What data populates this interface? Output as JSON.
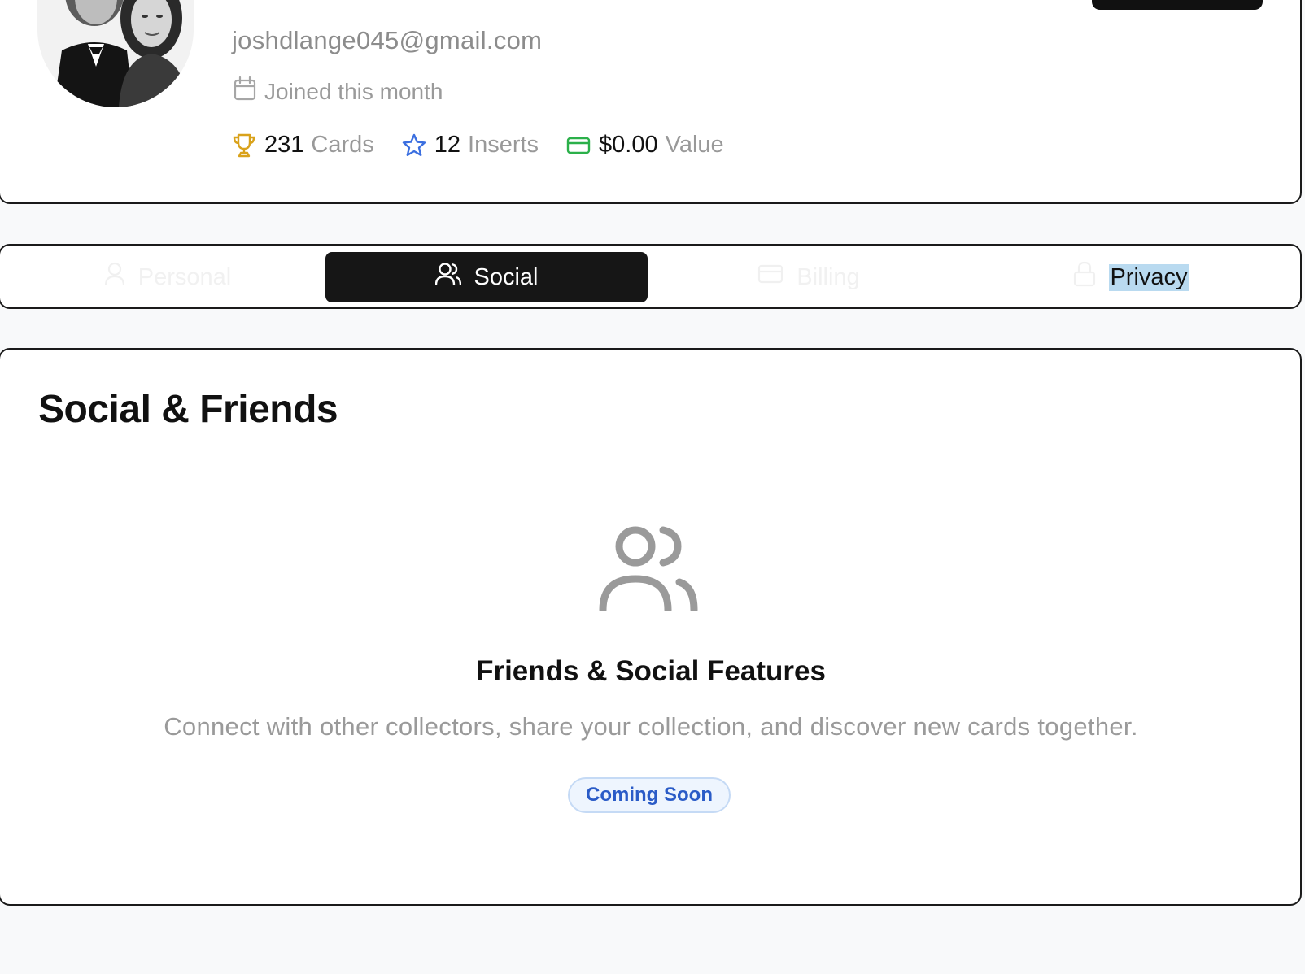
{
  "profile": {
    "email": "joshdlange045@gmail.com",
    "joined": "Joined this month",
    "stats": [
      {
        "icon": "trophy-icon",
        "value": "231",
        "label": "Cards",
        "color": "#d9a21b"
      },
      {
        "icon": "star-icon",
        "value": "12",
        "label": "Inserts",
        "color": "#3b6fe0"
      },
      {
        "icon": "credit-card-icon",
        "value": "$0.00",
        "label": "Value",
        "color": "#2bb04a"
      }
    ]
  },
  "tabs": [
    {
      "label": "Personal",
      "icon": "user-icon",
      "state": "inactive"
    },
    {
      "label": "Social",
      "icon": "users-icon",
      "state": "active"
    },
    {
      "label": "Billing",
      "icon": "credit-card-icon",
      "state": "inactive"
    },
    {
      "label": "Privacy",
      "icon": "lock-icon",
      "state": "inactive-highlighted"
    }
  ],
  "social": {
    "title": "Social & Friends",
    "feature_title": "Friends & Social Features",
    "feature_description": "Connect with other collectors, share your collection, and discover new cards together.",
    "badge": "Coming Soon"
  },
  "colors": {
    "accent_dark": "#161616",
    "badge_text": "#2a5bc7",
    "badge_bg": "#eef5fe",
    "muted_text": "#9a9a9a"
  }
}
